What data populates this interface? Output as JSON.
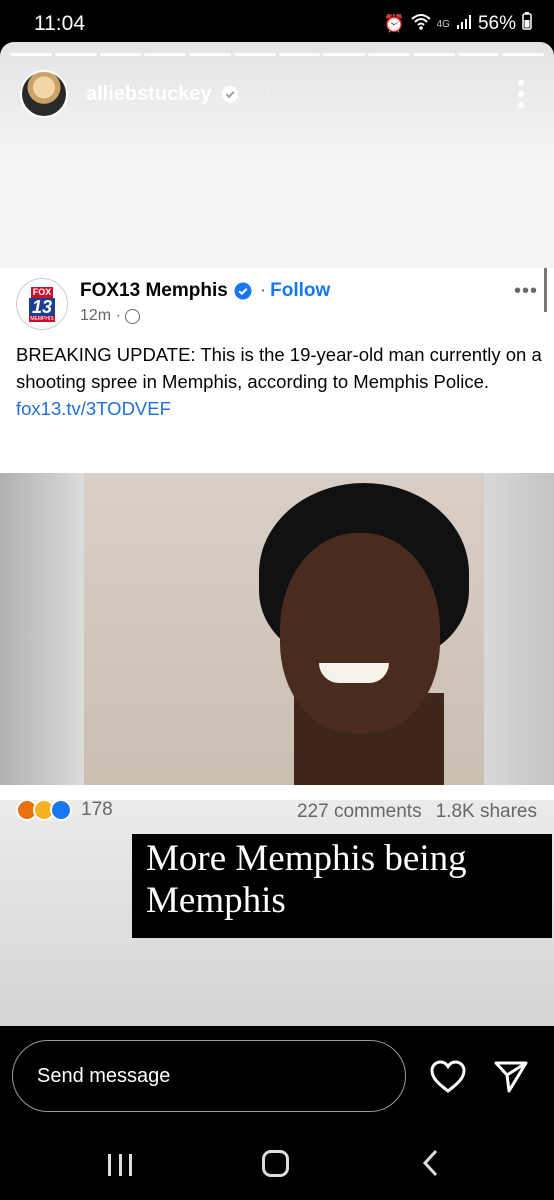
{
  "status_bar": {
    "time": "11:04",
    "network": "4G",
    "battery": "56%"
  },
  "story": {
    "username": "alliebstuckey",
    "time_ago": "2h",
    "progress_segments": 12
  },
  "post": {
    "page_name": "FOX13 Memphis",
    "follow_label": "Follow",
    "dot_separator": "·",
    "time": "12m ·",
    "logo_fox": "FOX",
    "logo_number": "13",
    "logo_city": "MEMPHIS",
    "text": "BREAKING UPDATE:  This is the 19-year-old man currently on a shooting spree in Memphis, according to Memphis Police. ",
    "link": "fox13.tv/3TODVEF",
    "reaction_count": "178",
    "comments": "227 comments",
    "shares": "1.8K shares"
  },
  "caption": {
    "text": "More Memphis being Memphis"
  },
  "reply": {
    "placeholder": "Send message"
  },
  "colors": {
    "follow": "#1877f2",
    "link": "#216fdb",
    "verified": "#1877f2"
  },
  "icons": {
    "alarm": "alarm-icon",
    "wifi": "wifi-icon",
    "signal": "signal-icon",
    "battery": "battery-icon",
    "verified": "verified-badge-icon",
    "more": "more-vert-icon",
    "heart": "heart-icon",
    "send": "send-icon"
  }
}
